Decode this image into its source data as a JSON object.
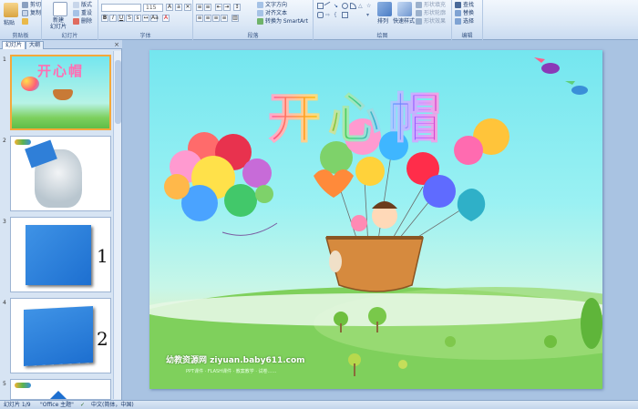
{
  "ribbon": {
    "clipboard": {
      "label": "剪贴板",
      "paste": "粘贴",
      "cut": "剪切",
      "copy": "复制",
      "format_painter": "格式刷"
    },
    "slides": {
      "label": "幻灯片",
      "new_slide": "新建",
      "new_slide_2": "幻灯片",
      "layout": "版式",
      "reset": "重设",
      "delete": "删除"
    },
    "font": {
      "label": "字体",
      "font_name": "",
      "font_size": "115"
    },
    "paragraph": {
      "label": "段落",
      "text_direction": "文字方向",
      "align_text": "对齐文本",
      "smartart": "转换为 SmartArt"
    },
    "drawing": {
      "label": "绘图",
      "arrange": "排列",
      "quick_styles": "快速样式",
      "shape_fill": "形状填充",
      "shape_outline": "形状轮廓",
      "shape_effects": "形状效果"
    },
    "editing": {
      "label": "编辑",
      "find": "查找",
      "replace": "替换",
      "select": "选择"
    }
  },
  "panel": {
    "tabs": [
      "幻灯片",
      "大纲"
    ],
    "close": "×",
    "thumbnails": [
      {
        "num": "1",
        "caption": "开心帽"
      },
      {
        "num": "2",
        "caption": ""
      },
      {
        "num": "3",
        "caption": "1"
      },
      {
        "num": "4",
        "caption": "2"
      },
      {
        "num": "5",
        "caption": ""
      }
    ]
  },
  "slide": {
    "title": "开心帽",
    "site": "幼教资源网 ziyuan.baby611.com",
    "site_sub": "PPT课件 · FLASH课件 · 教案教学 · 试卷……"
  },
  "status": {
    "slide_count": "幻灯片 1/9",
    "theme": "\"Office 主题\"",
    "language": "中文(简体，中国)"
  },
  "colors": {
    "ribbon_bg": "#dce8f6",
    "slide_sky": "#74e6ef",
    "grass": "#64c14a",
    "selected_border": "#f4a83a"
  }
}
